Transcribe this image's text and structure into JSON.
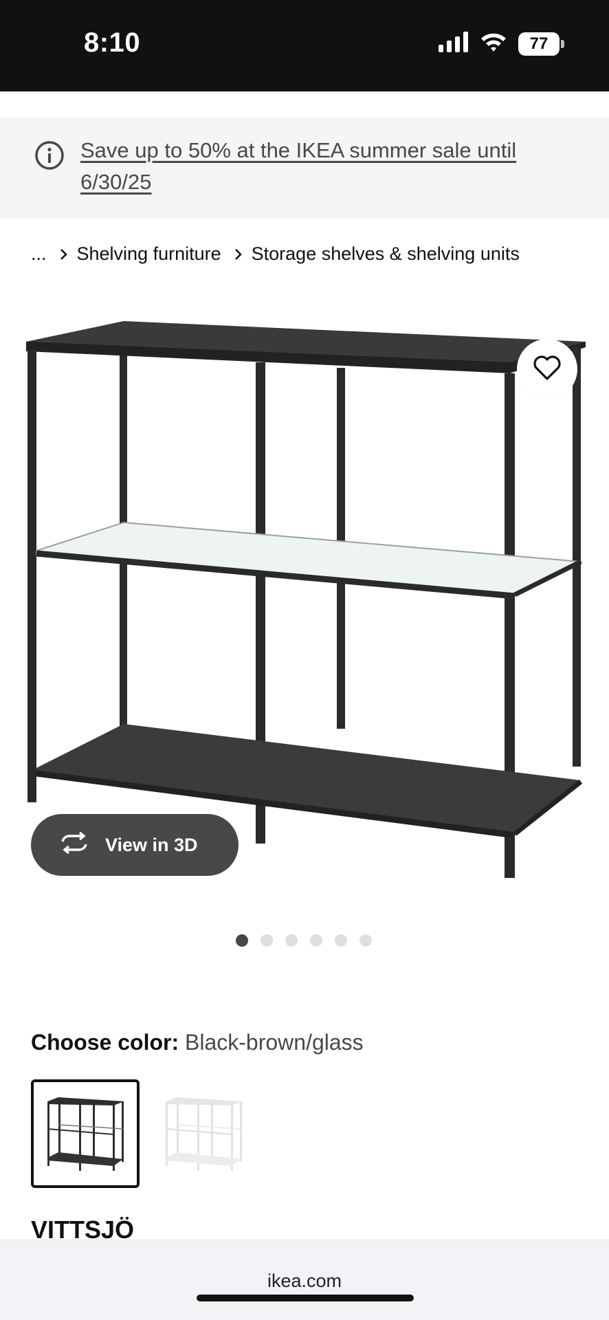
{
  "status_bar": {
    "time": "8:10",
    "battery_level": "77",
    "icons": [
      "signal-icon",
      "wifi-icon",
      "battery-icon"
    ]
  },
  "promo": {
    "icon": "info-icon",
    "text": "Save up to 50% at the IKEA summer sale until 6/30/25"
  },
  "breadcrumb": {
    "ellipsis": "...",
    "items": [
      "Shelving furniture",
      "Storage shelves & shelving units"
    ]
  },
  "gallery": {
    "favorite_icon": "heart-icon",
    "view_3d_label": "View in 3D",
    "view_3d_icon": "rotate-3d-icon",
    "dot_count": 6,
    "active_dot": 1
  },
  "color_chooser": {
    "label": "Choose color:",
    "selected_value": "Black-brown/glass",
    "options": [
      {
        "selected": true,
        "frame_color": "#2e2e2e"
      },
      {
        "selected": false,
        "frame_color": "#e6e6e6"
      }
    ]
  },
  "product": {
    "name": "VITTSJÖ"
  },
  "browser": {
    "url": "ikea.com"
  }
}
